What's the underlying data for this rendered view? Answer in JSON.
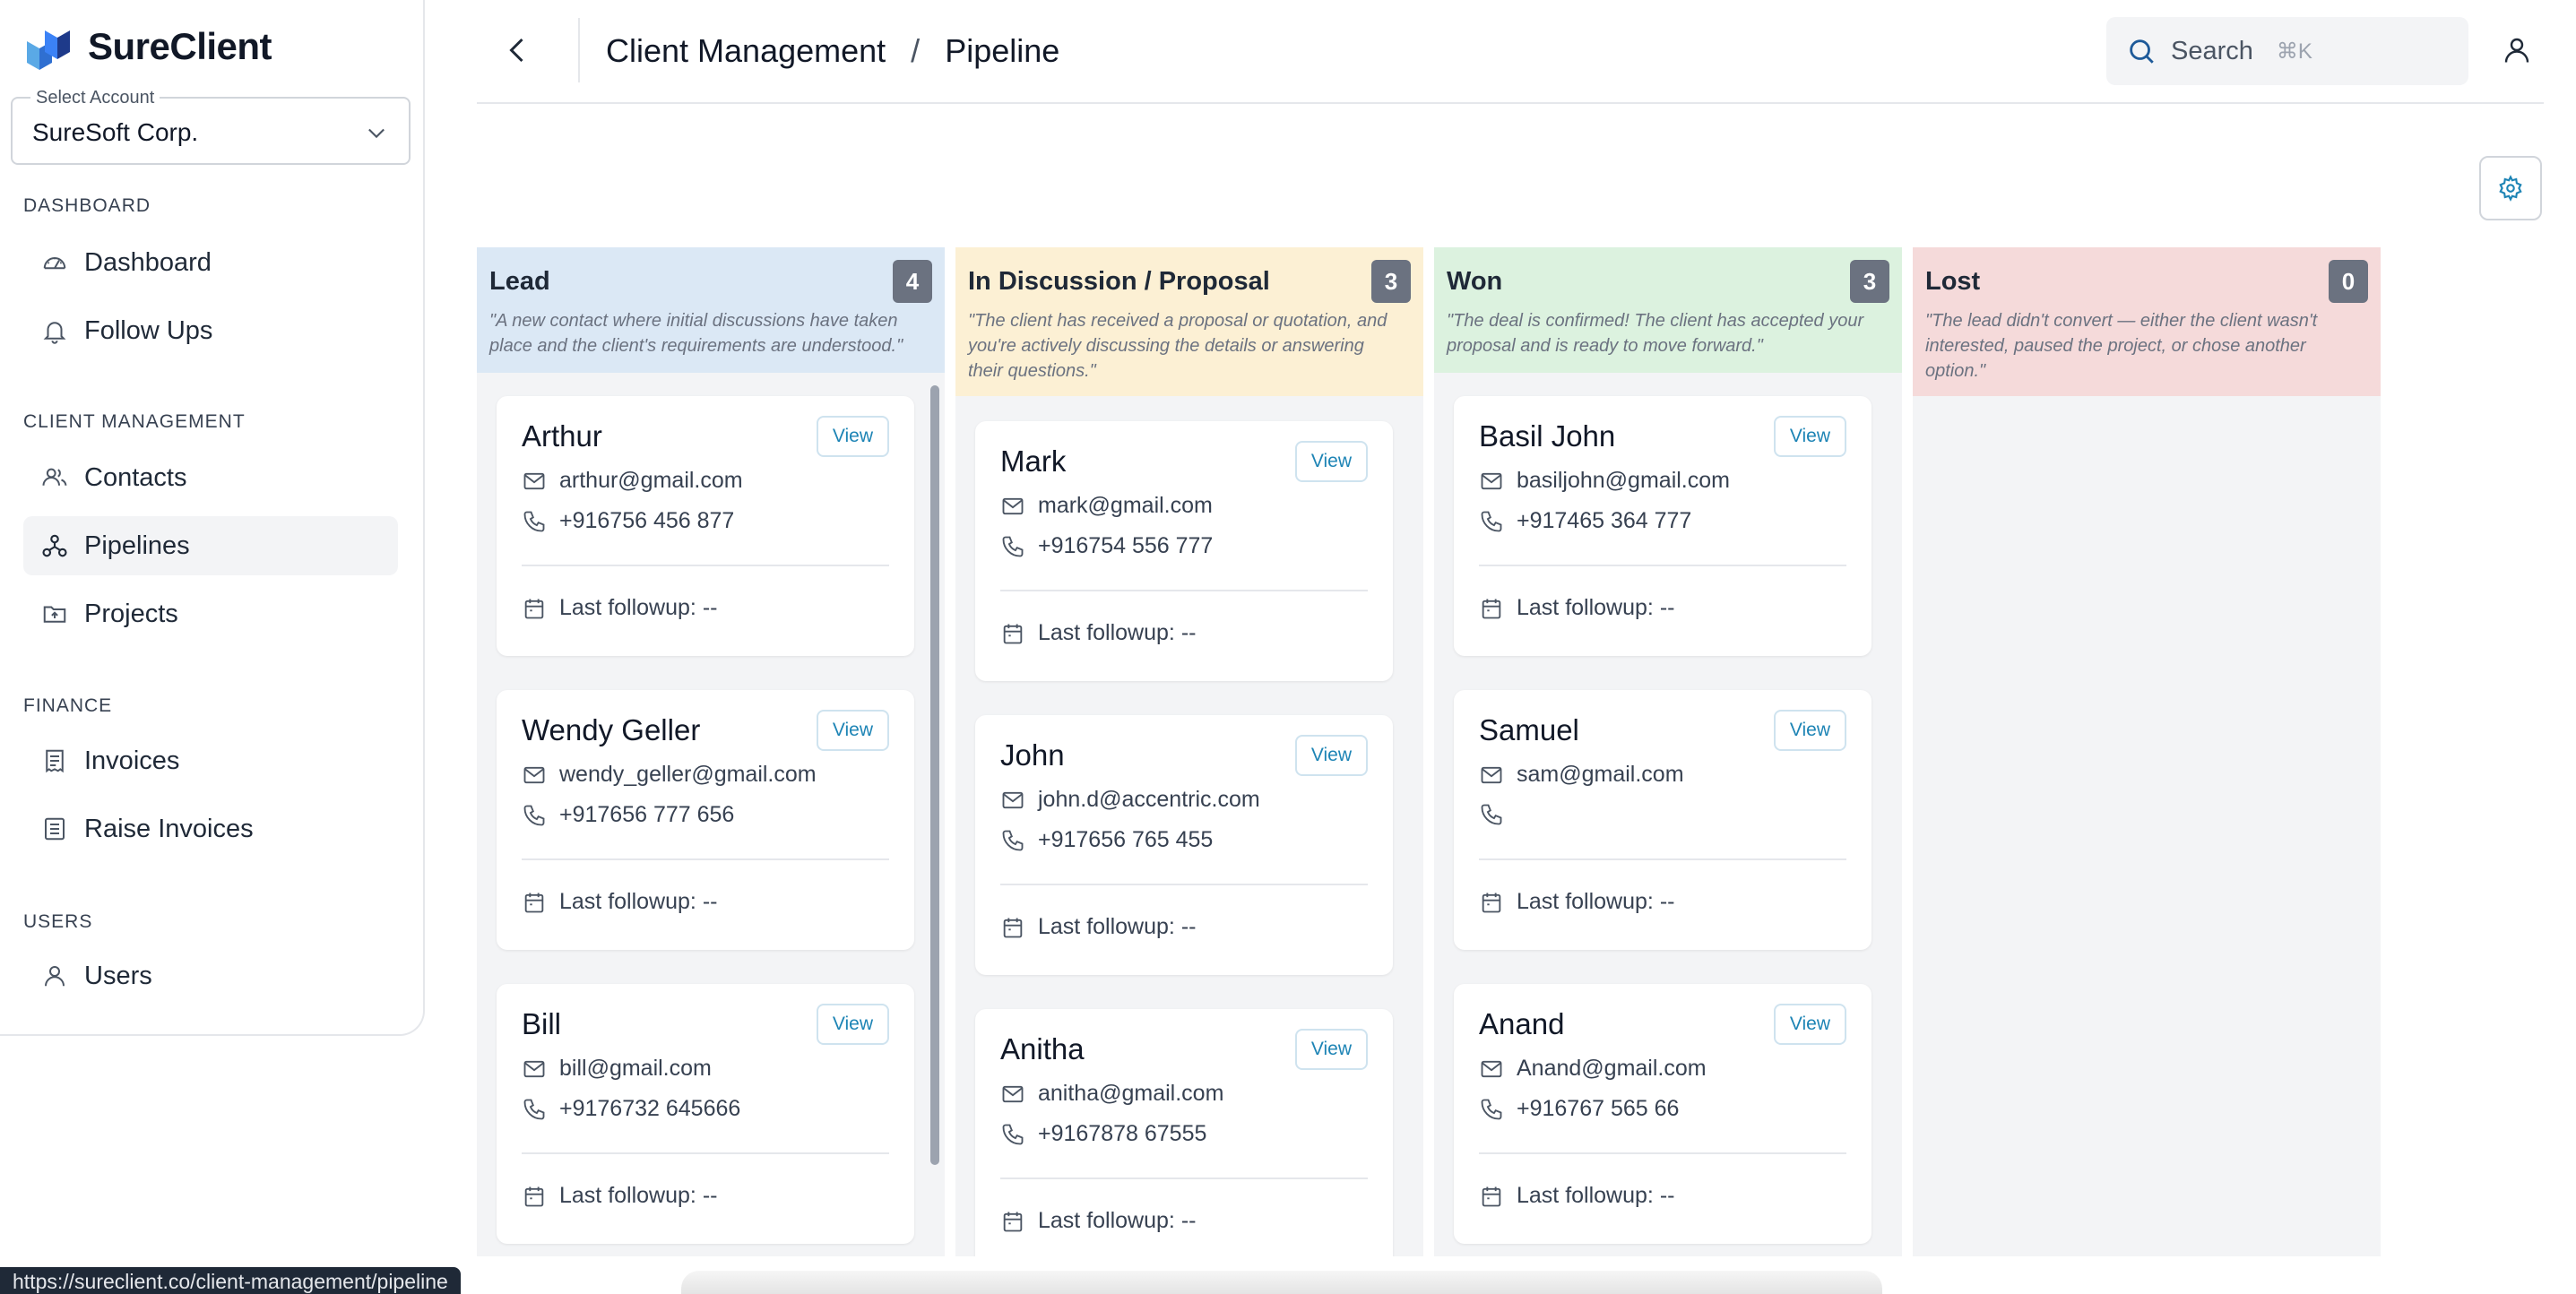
{
  "app": {
    "name": "SureClient"
  },
  "account": {
    "label": "Select Account",
    "value": "SureSoft Corp."
  },
  "sidebar": {
    "sections": [
      {
        "title": "DASHBOARD",
        "items": [
          {
            "label": "Dashboard",
            "icon": "gauge-icon"
          },
          {
            "label": "Follow Ups",
            "icon": "bell-icon"
          }
        ]
      },
      {
        "title": "CLIENT MANAGEMENT",
        "items": [
          {
            "label": "Contacts",
            "icon": "users-icon"
          },
          {
            "label": "Pipelines",
            "icon": "pipeline-icon",
            "active": true
          },
          {
            "label": "Projects",
            "icon": "folder-icon"
          }
        ]
      },
      {
        "title": "FINANCE",
        "items": [
          {
            "label": "Invoices",
            "icon": "receipt-icon"
          },
          {
            "label": "Raise Invoices",
            "icon": "document-icon"
          }
        ]
      },
      {
        "title": "USERS",
        "items": [
          {
            "label": "Users",
            "icon": "user-icon"
          }
        ]
      }
    ]
  },
  "header": {
    "breadcrumb": [
      "Client Management",
      "Pipeline"
    ],
    "breadcrumb_sep": "/",
    "search_placeholder": "Search",
    "search_shortcut": "⌘K"
  },
  "columns": [
    {
      "title": "Lead",
      "count": "4",
      "color": "#dbe8f5",
      "description": "\"A new contact where initial discussions have taken place and the client's requirements are understood.\"",
      "cards": [
        {
          "name": "Arthur",
          "email": "arthur@gmail.com",
          "phone": "+916756 456 877",
          "followup": "Last followup: --"
        },
        {
          "name": "Wendy Geller",
          "email": "wendy_geller@gmail.com",
          "phone": "+917656 777 656",
          "followup": "Last followup: --"
        },
        {
          "name": "Bill",
          "email": "bill@gmail.com",
          "phone": "+9176732 645666",
          "followup": "Last followup: --"
        }
      ]
    },
    {
      "title": "In Discussion / Proposal",
      "count": "3",
      "color": "#fcf0d4",
      "description": "\"The client has received a proposal or quotation, and you're actively discussing the details or answering their questions.\"",
      "cards": [
        {
          "name": "Mark",
          "email": "mark@gmail.com",
          "phone": "+916754 556 777",
          "followup": "Last followup: --"
        },
        {
          "name": "John",
          "email": "john.d@accentric.com",
          "phone": "+917656 765 455",
          "followup": "Last followup: --"
        },
        {
          "name": "Anitha",
          "email": "anitha@gmail.com",
          "phone": "+9167878 67555",
          "followup": "Last followup: --"
        }
      ]
    },
    {
      "title": "Won",
      "count": "3",
      "color": "#dcf2df",
      "description": "\"The deal is confirmed! The client has accepted your proposal and is ready to move forward.\"",
      "cards": [
        {
          "name": "Basil John",
          "email": "basiljohn@gmail.com",
          "phone": "+917465 364 777",
          "followup": "Last followup: --"
        },
        {
          "name": "Samuel",
          "email": "sam@gmail.com",
          "phone": "",
          "followup": "Last followup: --"
        },
        {
          "name": "Anand",
          "email": "Anand@gmail.com",
          "phone": "+916767 565 66",
          "followup": "Last followup: --"
        }
      ]
    },
    {
      "title": "Lost",
      "count": "0",
      "color": "#f5dada",
      "description": "\"The lead didn't convert — either the client wasn't interested, paused the project, or chose another option.\"",
      "cards": []
    }
  ],
  "card_view_label": "View",
  "status_url": "https://sureclient.co/client-management/pipeline"
}
